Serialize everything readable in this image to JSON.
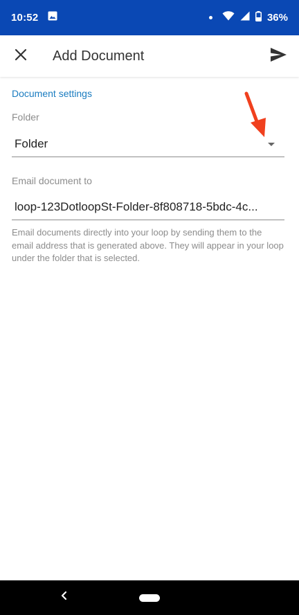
{
  "status_bar": {
    "time": "10:52",
    "battery": "36%",
    "icons": [
      "image-icon",
      "notification-dot-icon",
      "wifi-icon",
      "signal-icon",
      "battery-icon"
    ],
    "background_color": "#0a48b4"
  },
  "app_bar": {
    "title": "Add Document",
    "close_icon": "close-icon",
    "send_icon": "send-icon"
  },
  "form": {
    "section_title": "Document settings",
    "folder_label": "Folder",
    "folder_value": "Folder",
    "email_label": "Email document to",
    "email_value": "loop-123DotloopSt-Folder-8f808718-5bdc-4c...",
    "help_text": "Email documents directly into your loop by sending them to the email address that is generated above. They will appear in your loop under the folder that is selected.",
    "accent_color": "#1a7cc0"
  },
  "annotation": {
    "arrow_color": "#f0401e"
  },
  "nav_bar": {
    "back_icon": "back-chevron-icon",
    "home_icon": "home-pill-icon"
  }
}
